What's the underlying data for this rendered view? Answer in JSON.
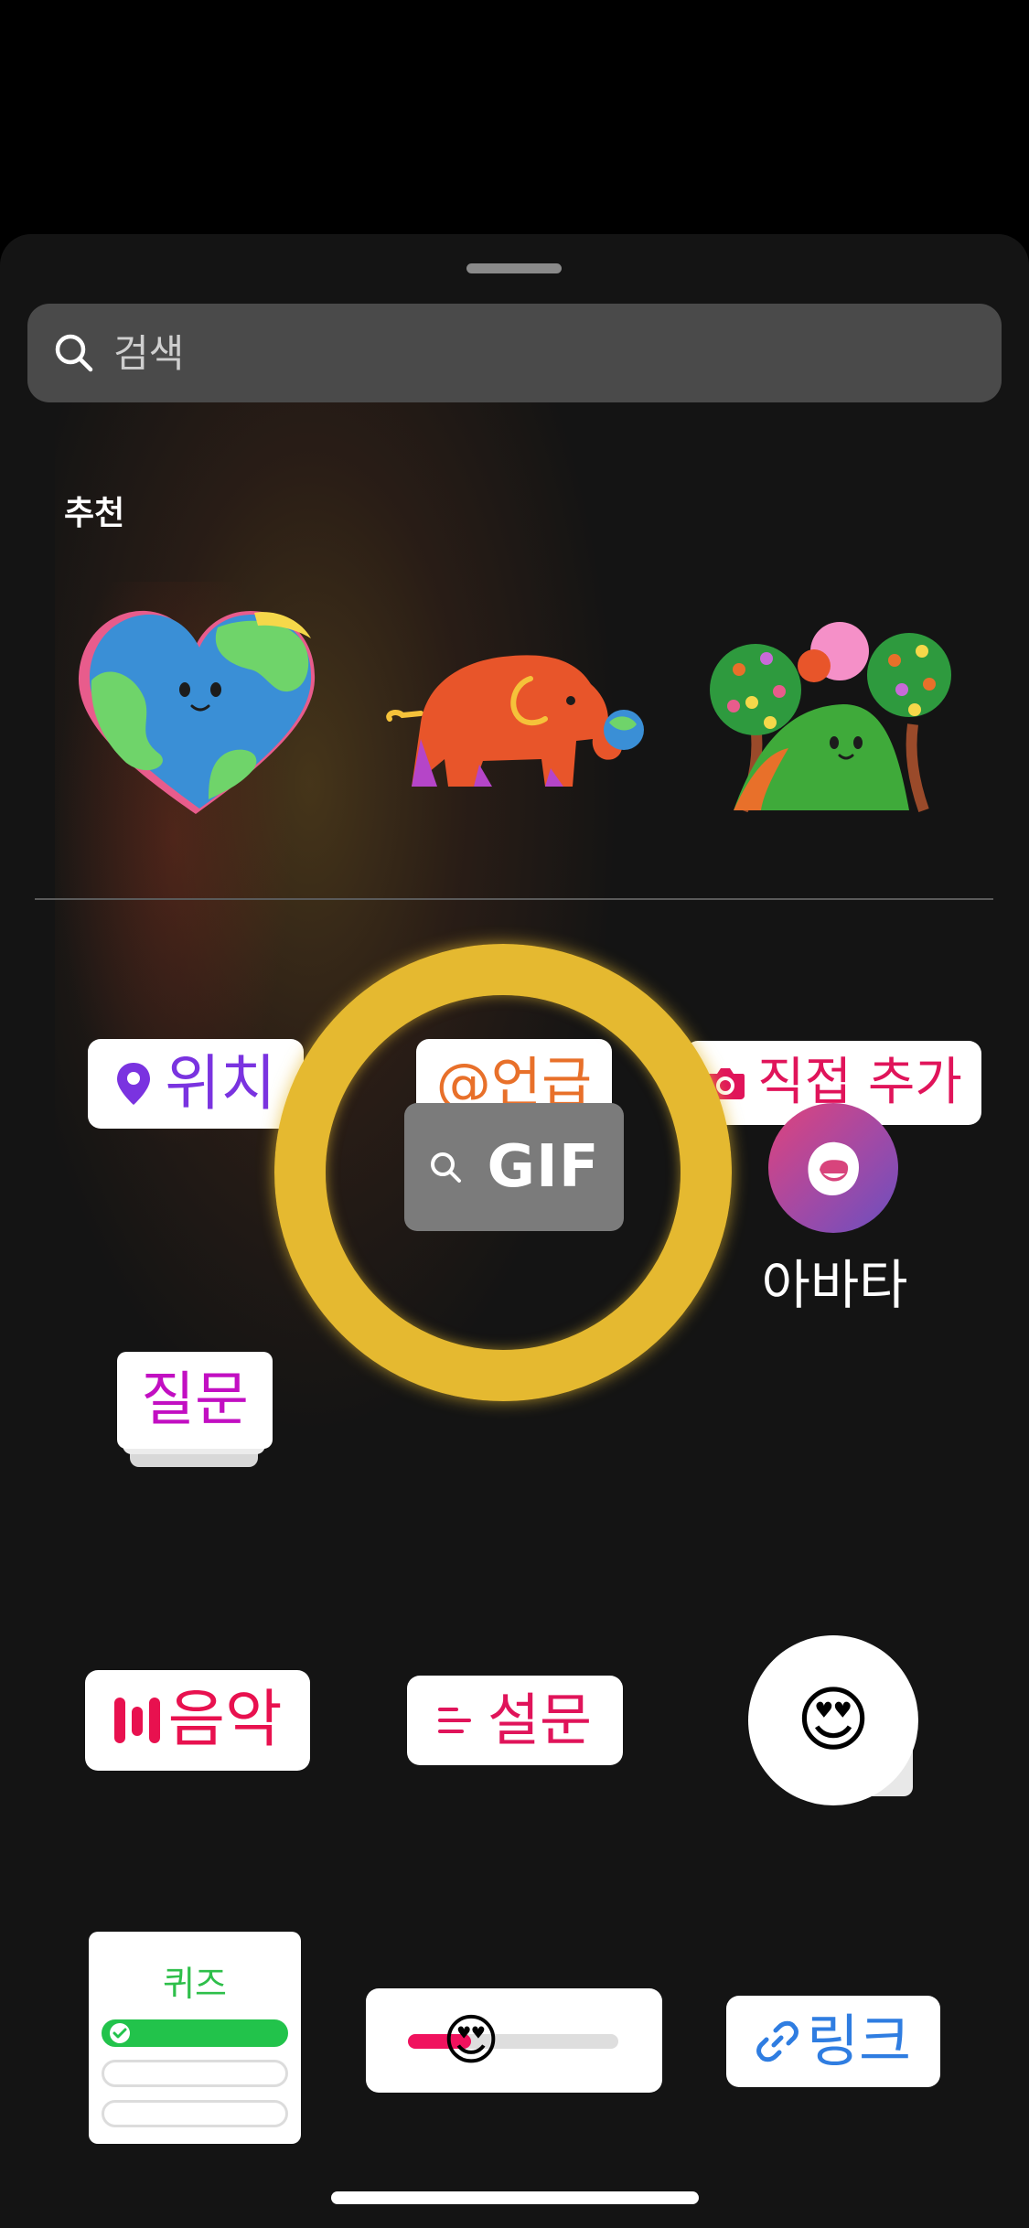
{
  "search": {
    "placeholder": "검색"
  },
  "recommended": {
    "title": "추천",
    "stickers": [
      "earth-heart-sticker",
      "elephant-globe-sticker",
      "hill-trees-sticker"
    ]
  },
  "stickers": {
    "location": {
      "label": "위치",
      "color": "#7a33e0",
      "icon": "location-pin-icon"
    },
    "mention": {
      "label": "@언급",
      "color": "#e8702a",
      "icon": "at-icon"
    },
    "add_yours": {
      "label": "직접 추가",
      "color": "#e0145a",
      "icon": "camera-icon"
    },
    "question": {
      "label": "질문",
      "color": "#c20fc2"
    },
    "gif": {
      "label": "GIF",
      "icon": "search-icon"
    },
    "avatar": {
      "label": "아바타",
      "icon": "avatar-face-icon"
    },
    "music": {
      "label": "음악",
      "color": "#e8114f",
      "icon": "music-bars-icon"
    },
    "poll": {
      "label": "설문",
      "color": "#e0145a",
      "icon": "poll-lines-icon"
    },
    "emoji_reaction": {
      "emoji": "😍"
    },
    "quiz": {
      "label": "퀴즈",
      "color": "#2ebf4a"
    },
    "emoji_slider": {
      "emoji": "😍",
      "value_fraction": 0.3
    },
    "link": {
      "label": "링크",
      "color": "#2f7de1",
      "icon": "link-icon"
    }
  },
  "colors": {
    "sheet_bg": "#141414",
    "search_bg": "#4a4a4a",
    "gif_ring": "#e5b930"
  }
}
